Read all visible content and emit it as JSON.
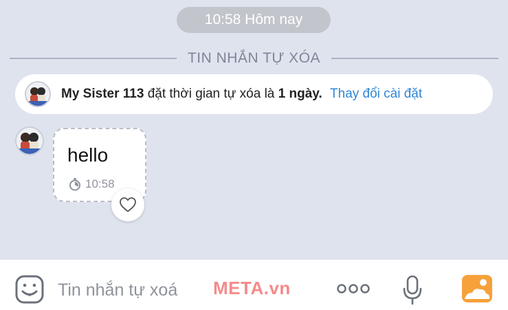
{
  "timestamp_pill": "10:58 Hôm nay",
  "divider": {
    "label": "TIN NHẮN TỰ XÓA"
  },
  "system_notice": {
    "name": "My Sister 113",
    "text_before": "đặt thời gian tự xóa là",
    "days": "1 ngày.",
    "link": "Thay đổi cài đặt"
  },
  "message": {
    "text": "hello",
    "time": "10:58",
    "timer_icon": "timer-icon"
  },
  "composer": {
    "placeholder": "Tin nhắn tự xoá",
    "watermark": "META.vn",
    "icons": [
      "emoji-icon",
      "more-icon",
      "microphone-icon",
      "photo-icon"
    ]
  },
  "colors": {
    "background": "#dfe3ee",
    "link": "#2f86d8",
    "time_pill": "#c2c5cc",
    "photo_icon": "#f6a13a"
  }
}
